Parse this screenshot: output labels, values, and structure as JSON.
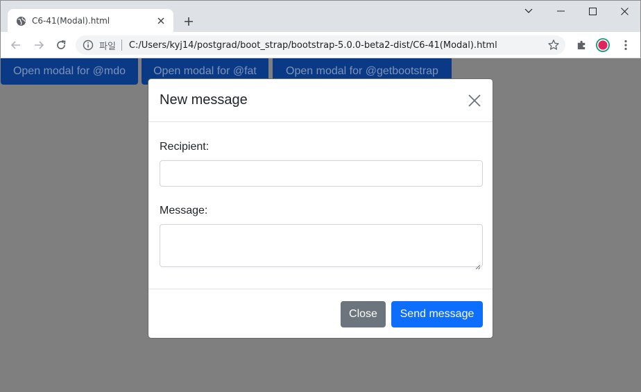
{
  "browser": {
    "tab_title": "C6-41(Modal).html",
    "url_scheme": "파일",
    "url": "C:/Users/kyj14/postgrad/boot_strap/bootstrap-5.0.0-beta2-dist/C6-41(Modal).html"
  },
  "page": {
    "buttons": [
      {
        "label": "Open modal for @mdo"
      },
      {
        "label": "Open modal for @fat"
      },
      {
        "label": "Open modal for @getbootstrap"
      }
    ]
  },
  "modal": {
    "title": "New message",
    "recipient_label": "Recipient:",
    "recipient_value": "",
    "message_label": "Message:",
    "message_value": "",
    "close_label": "Close",
    "send_label": "Send message"
  },
  "colors": {
    "backdrop": "#7f7f7f",
    "primary": "#0d6efd",
    "secondary": "#6c757d",
    "launch_button": "#0a3a85"
  }
}
